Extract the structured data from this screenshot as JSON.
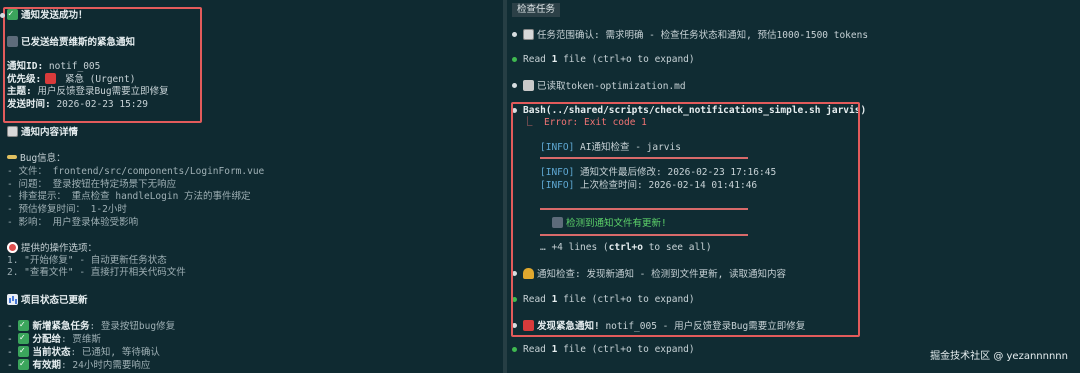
{
  "left": {
    "success_title": "通知发送成功！",
    "sent_to": "已发送给贾维斯的紧急通知",
    "notif_id_label": "通知ID:",
    "notif_id_value": " notif_005",
    "priority_label": "优先级:",
    "priority_value": " 紧急 (Urgent)",
    "subject_label": "主题:",
    "subject_value": " 用户反馈登录Bug需要立即修复",
    "sent_time_label": "发送时间:",
    "sent_time_value": " 2026-02-23 15:29",
    "details_title": "通知内容详情",
    "bug_info_title": "Bug信息：",
    "bug_lines": [
      "- 文件： frontend/src/components/LoginForm.vue",
      "- 问题： 登录按钮在特定场景下无响应",
      "- 排查提示： 重点检查 handleLogin 方法的事件绑定",
      "- 预估修复时间： 1-2小时",
      "- 影响： 用户登录体验受影响"
    ],
    "options_title": "提供的操作选项：",
    "option_lines": [
      "1. \"开始修复\" - 自动更新任务状态",
      "2. \"查看文件\" - 直接打开相关代码文件"
    ],
    "project_title": "项目状态已更新",
    "project_items": [
      {
        "key": "新增紧急任务",
        "value": ": 登录按钮bug修复"
      },
      {
        "key": "分配给",
        "value": ": 贾维斯"
      },
      {
        "key": "当前状态",
        "value": ": 已通知, 等待确认"
      },
      {
        "key": "有效期",
        "value": ": 24小时内需要响应"
      }
    ]
  },
  "right": {
    "tab_title": "检查任务",
    "scope_line": "任务范围确认: 需求明确 - 检查任务状态和通知, 预估1000-1500 tokens",
    "read1_pre": "Read ",
    "read1_num": "1",
    "read1_post": " file (ctrl+o to expand)",
    "read_token": "已读取token-optimization.md",
    "bash_cmd": "Bash(../shared/scripts/check_notifications_simple.sh jarvis)",
    "error_line": "⎿  Error: Exit code 1",
    "info_tag": "[INFO]",
    "info1": " AI通知检查 - jarvis",
    "info2": " 通知文件最后修改: 2026-02-23 17:16:45",
    "info3": " 上次检查时间: 2026-02-14 01:41:46",
    "detected": "检测到通知文件有更新!",
    "more_lines_pre": "… +4 lines (",
    "more_lines_key": "ctrl+o",
    "more_lines_post": " to see all)",
    "check_line": "通知检查: 发现新通知 - 检测到文件更新, 读取通知内容",
    "read2_pre": "Read ",
    "read2_num": "1",
    "read2_post": " file (ctrl+o to expand)",
    "urgent_bold": "发现紧急通知!",
    "urgent_rest": " notif_005 - 用户反馈登录Bug需要立即修复",
    "read3_pre": "Read ",
    "read3_num": "1",
    "read3_post": " file (ctrl+o to expand)",
    "watermark": "掘金技术社区 @ yezannnnnn"
  }
}
